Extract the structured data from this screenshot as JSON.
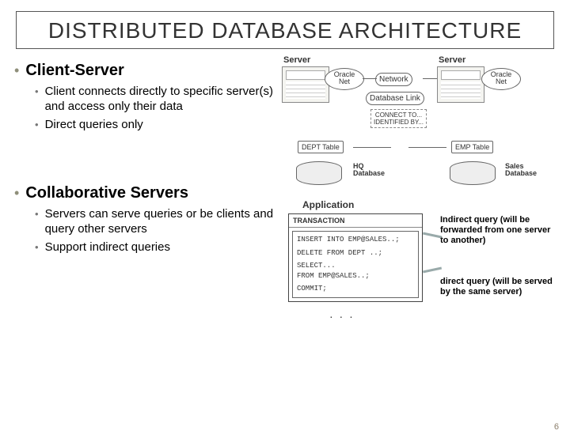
{
  "title": "DISTRIBUTED DATABASE ARCHITECTURE",
  "sections": [
    {
      "heading": "Client-Server",
      "bullets": [
        "Client connects directly to specific server(s) and access only their data",
        "Direct queries only"
      ]
    },
    {
      "heading": "Collaborative Servers",
      "bullets": [
        "Servers can serve queries or be clients and query other servers",
        "Support indirect queries"
      ]
    }
  ],
  "diagram": {
    "server_label": "Server",
    "oracle_net": "Oracle\nNet",
    "network": "Network",
    "db_link": "Database Link",
    "connect_to": "CONNECT TO...\nIDENTIFIED BY...",
    "dept_table": "DEPT Table",
    "emp_table": "EMP Table",
    "hq_db": "HQ\nDatabase",
    "sales_db": "Sales\nDatabase",
    "application": "Application",
    "transaction": "TRANSACTION",
    "code": {
      "l1": "INSERT INTO EMP@SALES..;",
      "l2": "DELETE FROM DEPT ..;",
      "l3": "SELECT...\nFROM EMP@SALES..;",
      "l4": "COMMIT;"
    }
  },
  "annotations": {
    "indirect": "Indirect query (will be forwarded from one server to another)",
    "direct": "direct query (will be served by the same server)"
  },
  "slide_number": "6"
}
